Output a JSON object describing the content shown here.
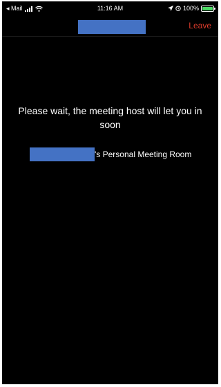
{
  "status_bar": {
    "back_app": "◂ Mail",
    "time": "11:16 AM",
    "battery_percent": "100%",
    "battery_level": 1.0,
    "icons": [
      "signal-icon",
      "wifi-icon",
      "location-icon",
      "alarm-icon",
      "battery-icon"
    ]
  },
  "navbar": {
    "title": "",
    "leave_label": "Leave"
  },
  "waiting_room": {
    "message": "Please wait, the meeting host will let you in soon",
    "host_name": "",
    "room_suffix": "'s Personal Meeting Room"
  },
  "colors": {
    "background": "#000000",
    "leave": "#e03c2c",
    "redaction": "#4472c4",
    "battery": "#4cd964"
  }
}
